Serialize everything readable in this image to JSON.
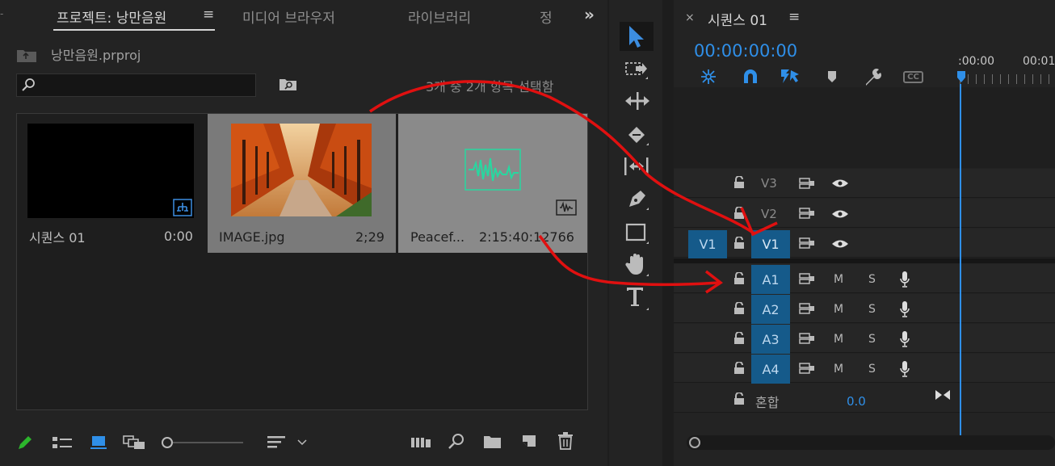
{
  "project": {
    "tabs": [
      {
        "label": "프로젝트: 낭만음원"
      },
      {
        "label": "미디어 브라우저"
      },
      {
        "label": "라이브러리"
      },
      {
        "label": "정"
      }
    ],
    "menu_glyph": "≡",
    "overflow_glyph": "»",
    "file_name": "낭만음원.prproj",
    "selection_status": "3개 중 2개 항목 선택함",
    "items": [
      {
        "name": "시퀀스 01",
        "duration": "0:00"
      },
      {
        "name": "IMAGE.jpg",
        "duration": "2;29"
      },
      {
        "name": "Peacef...",
        "duration": "2:15:40:12766"
      }
    ]
  },
  "timeline": {
    "title": "시퀀스 01",
    "close_glyph": "×",
    "menu_glyph": "≡",
    "timecode": "00:00:00:00",
    "ruler": [
      ":00:00",
      "00:01"
    ],
    "tracks_video": [
      {
        "label": "V3"
      },
      {
        "label": "V2"
      },
      {
        "label": "V1",
        "source": "V1"
      }
    ],
    "tracks_audio": [
      {
        "label": "A1"
      },
      {
        "label": "A2"
      },
      {
        "label": "A3"
      },
      {
        "label": "A4"
      }
    ],
    "mute_label": "M",
    "solo_label": "S",
    "mix_label": "혼합",
    "mix_value": "0.0",
    "cc_label": "CC"
  },
  "colors": {
    "accent_blue": "#2f8fe8",
    "track_target": "#155a8a",
    "annotation_red": "#e01010",
    "audio_wave": "#27d8a0"
  }
}
